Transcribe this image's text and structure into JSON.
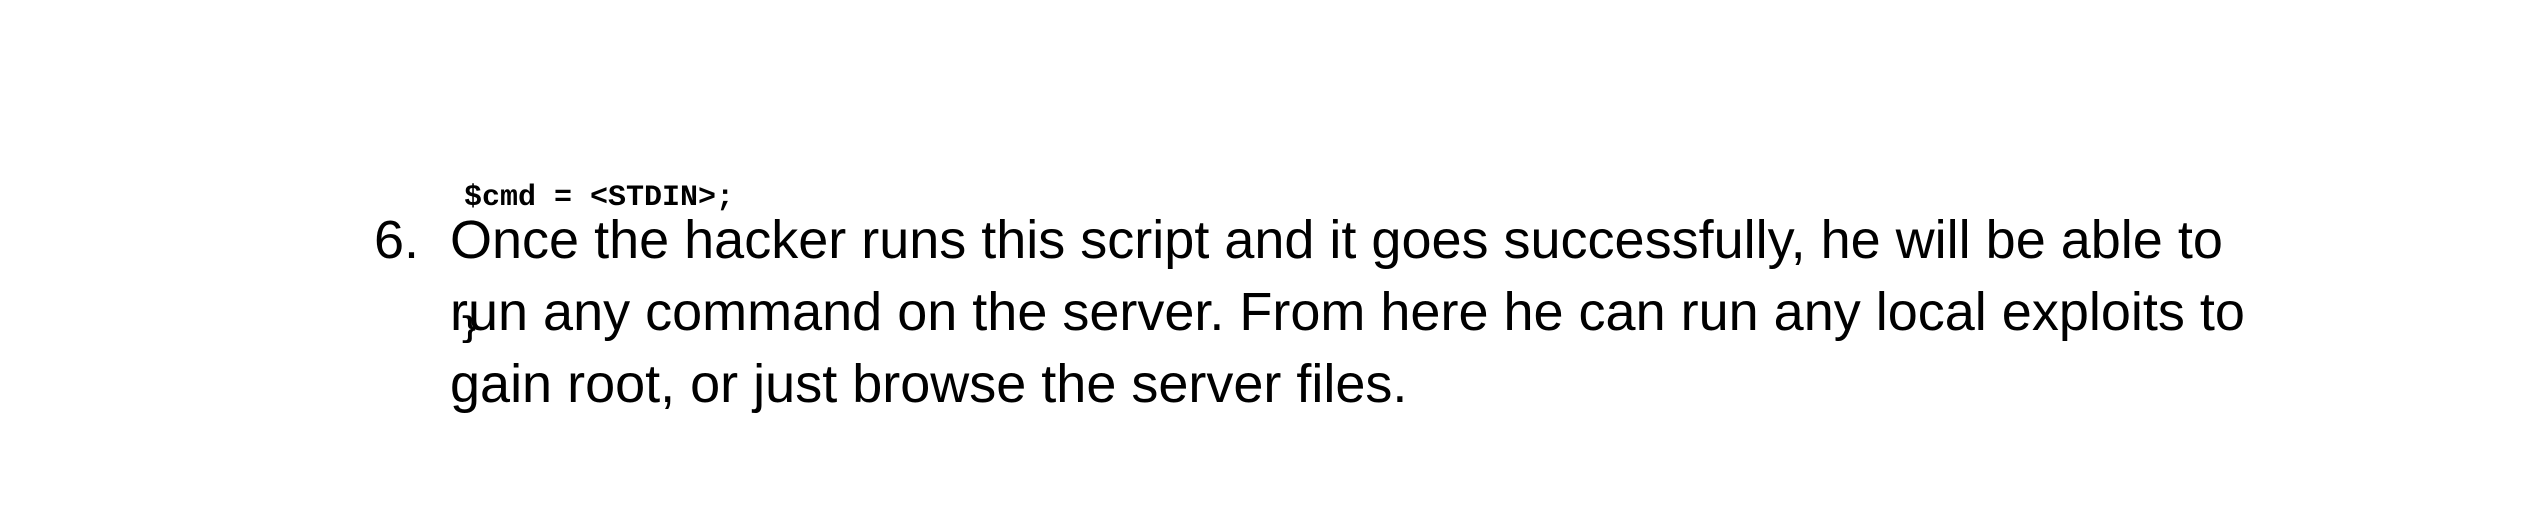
{
  "code": {
    "line1": "$cmd = <STDIN>;",
    "line2": "}"
  },
  "step": {
    "number": "6.",
    "lines": [
      " Once the hacker runs this script and it goes successfully, he will be able to",
      "run any command on the server. From here he can run any local exploits to",
      "gain root, or just browse the server files."
    ]
  }
}
